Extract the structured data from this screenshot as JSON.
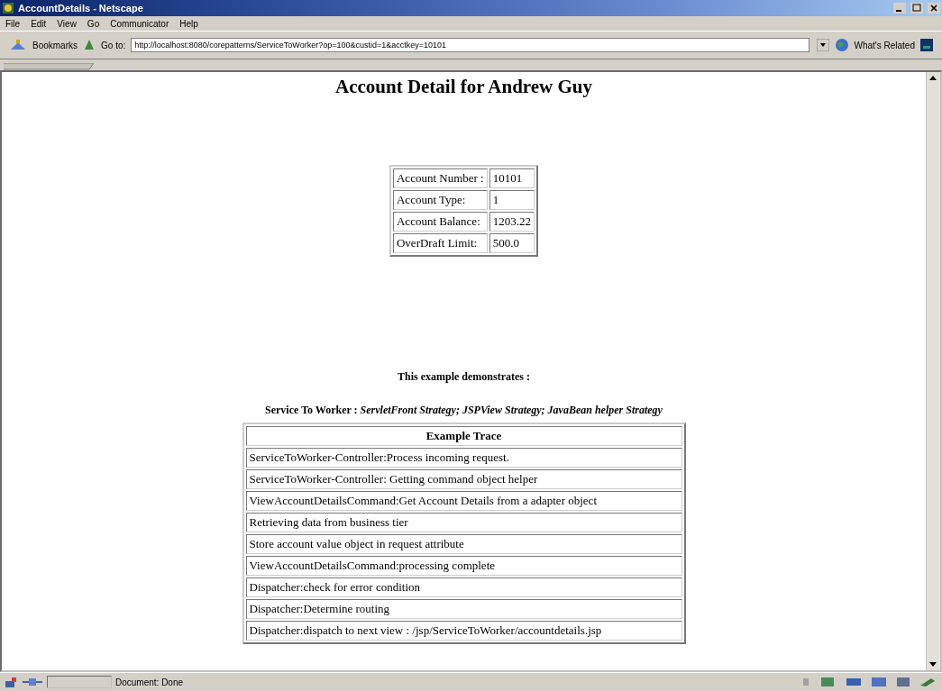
{
  "window": {
    "title": "AccountDetails - Netscape"
  },
  "menu": [
    "File",
    "Edit",
    "View",
    "Go",
    "Communicator",
    "Help"
  ],
  "toolbar": {
    "bookmarks": "Bookmarks",
    "goto_label": "Go to:",
    "url": "http://localhost:8080/corepatterns/ServiceToWorker?op=100&custid=1&acctkey=10101",
    "related": "What's Related"
  },
  "heading": "Account Detail for Andrew Guy",
  "account": [
    {
      "label": "Account Number :",
      "value": "10101"
    },
    {
      "label": "Account Type:",
      "value": "1"
    },
    {
      "label": "Account Balance:",
      "value": "1203.22"
    },
    {
      "label": "OverDraft Limit:",
      "value": "500.0"
    }
  ],
  "intro": "This example demonstrates :",
  "patterns": "Service To Worker : *ServletFront Strategy; JSPView Strategy; JavaBean helper Strategy*",
  "trace": {
    "title": "Example Trace",
    "rows": [
      "ServiceToWorker-Controller:Process incoming request.",
      "ServiceToWorker-Controller: Getting command object helper",
      "ViewAccountDetailsCommand:Get Account Details from a adapter object",
      "Retrieving data from business tier",
      "Store account value object in request attribute",
      "ViewAccountDetailsCommand:processing complete",
      "Dispatcher:check for error condition",
      "Dispatcher:Determine routing",
      "Dispatcher:dispatch to next view : /jsp/ServiceToWorker/accountdetails.jsp"
    ]
  },
  "status_bar": {
    "text": "Document: Done"
  }
}
